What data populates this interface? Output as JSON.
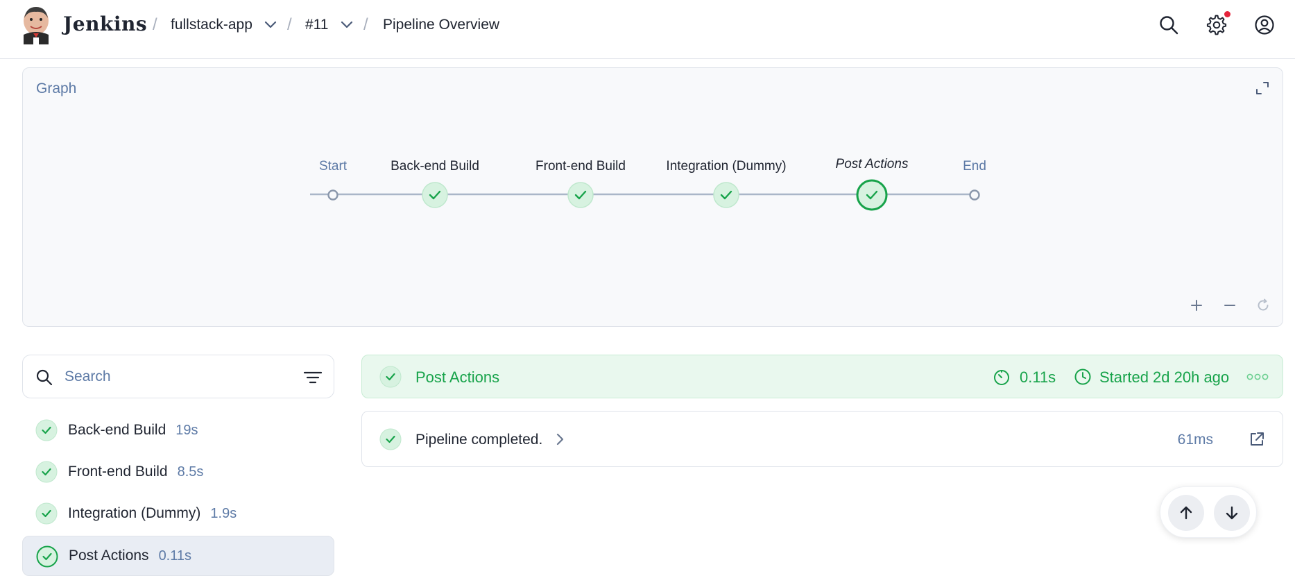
{
  "header": {
    "brand": "Jenkins",
    "breadcrumb": [
      {
        "label": "fullstack-app",
        "has_dropdown": true
      },
      {
        "label": "#11",
        "has_dropdown": true
      },
      {
        "label": "Pipeline Overview",
        "has_dropdown": false
      }
    ],
    "icons": [
      "search-icon",
      "settings-icon",
      "user-account-icon"
    ],
    "settings_has_notification": true
  },
  "graph": {
    "title": "Graph",
    "nodes": [
      {
        "label": "Start",
        "kind": "start"
      },
      {
        "label": "Back-end Build",
        "kind": "stage",
        "status": "success"
      },
      {
        "label": "Front-end Build",
        "kind": "stage",
        "status": "success"
      },
      {
        "label": "Integration (Dummy)",
        "kind": "stage",
        "status": "success"
      },
      {
        "label": "Post Actions",
        "kind": "stage",
        "status": "success",
        "selected": true
      },
      {
        "label": "End",
        "kind": "end"
      }
    ],
    "controls": [
      "zoom-in-icon",
      "zoom-out-icon",
      "reset-zoom-icon"
    ]
  },
  "search": {
    "placeholder": "Search",
    "value": ""
  },
  "stages": [
    {
      "name": "Back-end Build",
      "duration": "19s",
      "status": "success"
    },
    {
      "name": "Front-end Build",
      "duration": "8.5s",
      "status": "success"
    },
    {
      "name": "Integration (Dummy)",
      "duration": "1.9s",
      "status": "success"
    },
    {
      "name": "Post Actions",
      "duration": "0.11s",
      "status": "success",
      "active": true
    }
  ],
  "detail": {
    "title": "Post Actions",
    "duration": "0.11s",
    "started": "Started 2d 20h ago",
    "steps": [
      {
        "text": "Pipeline completed.",
        "duration": "61ms",
        "status": "success"
      }
    ]
  },
  "colors": {
    "success": "#17a34a",
    "success_bg": "#d7f2e0",
    "muted_text": "#5d7aa6",
    "notification": "#e5243b"
  }
}
